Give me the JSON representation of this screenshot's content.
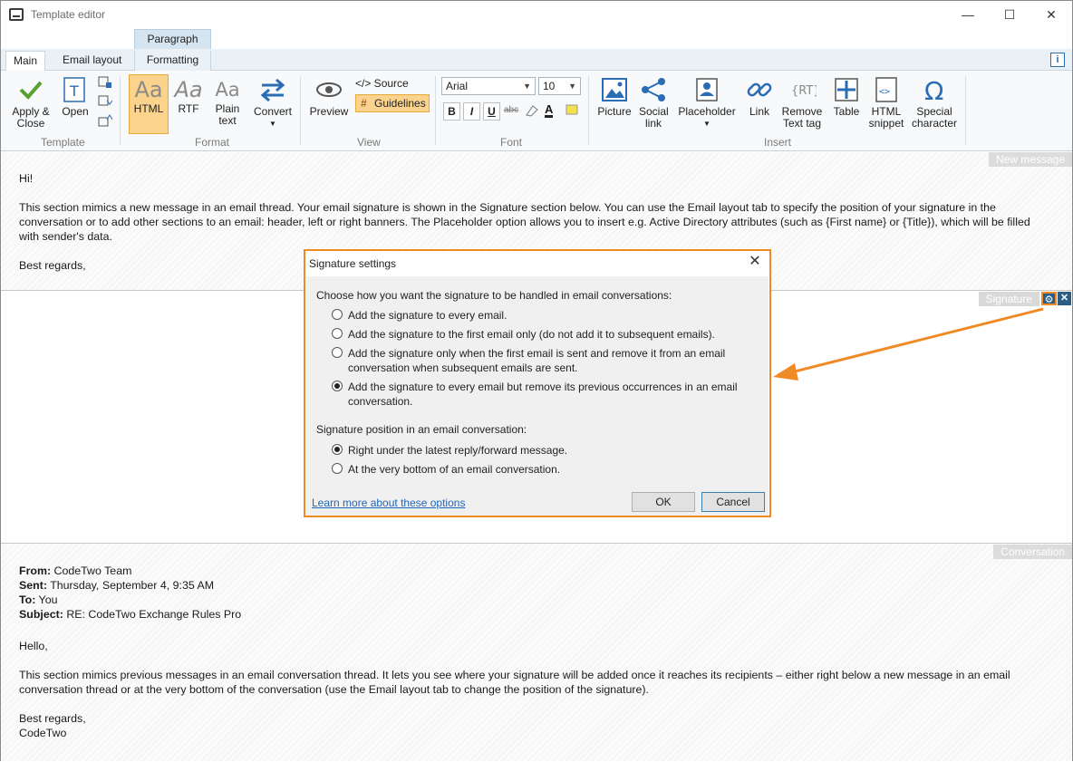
{
  "window": {
    "title": "Template editor",
    "minimize": "—",
    "maximize": "☐",
    "close": "✕"
  },
  "ribbon": {
    "contextual_tab": "Paragraph",
    "tabs": [
      {
        "label": "Main"
      },
      {
        "label": "Email layout"
      },
      {
        "label": "Formatting"
      }
    ],
    "info": "i",
    "template": {
      "apply_close": "Apply & Close",
      "open": "Open",
      "group": "Template"
    },
    "format": {
      "html": "HTML",
      "rtf": "RTF",
      "plain_text": "Plain text",
      "convert": "Convert",
      "aa": "Aa",
      "group": "Format"
    },
    "view": {
      "preview": "Preview",
      "source": "</> Source",
      "guidelines": "Guidelines",
      "group": "View"
    },
    "font": {
      "family": "Arial",
      "size": "10",
      "bold": "B",
      "italic": "I",
      "underline": "U",
      "strike": "abc",
      "color": "A",
      "group": "Font"
    },
    "insert": {
      "picture": "Picture",
      "social_link": "Social link",
      "placeholder": "Placeholder",
      "link": "Link",
      "remove_text_tag": "Remove Text tag",
      "table": "Table",
      "html_snippet": "HTML snippet",
      "special_character": "Special character",
      "group": "Insert"
    }
  },
  "sections": {
    "new_message": {
      "tag": "New message",
      "greeting": "Hi!",
      "body": "This section mimics a new message in an email thread. Your email signature is shown in the Signature section below. You can use the Email layout tab to specify the position of your signature in the conversation or to add other sections to an email: header, left or right banners. The Placeholder option allows you to insert e.g. Active Directory attributes (such as {First name} or {Title}), which will be filled with sender's data.",
      "closing": "Best regards,"
    },
    "signature": {
      "tag": "Signature",
      "settings_icon": "⚙",
      "close_icon": "✕"
    },
    "conversation": {
      "tag": "Conversation",
      "from_label": "From:",
      "from_value": " CodeTwo Team",
      "sent_label": "Sent:",
      "sent_value": " Thursday, September 4, 9:35 AM",
      "to_label": "To:",
      "to_value": " You",
      "subject_label": "Subject:",
      "subject_value": " RE: CodeTwo Exchange Rules Pro",
      "greeting": "Hello,",
      "body": "This section mimics previous messages in an email conversation thread. It lets you see where your signature will be added once it reaches its recipients – either right below a new message in an email conversation thread or at the very bottom of the conversation (use the Email layout tab to change the position of the signature).",
      "closing_1": "Best regards,",
      "closing_2": "CodeTwo"
    }
  },
  "dialog": {
    "title": "Signature settings",
    "close": "✕",
    "question_1": "Choose how you want the signature to be handled in email conversations:",
    "options_1": [
      {
        "label": "Add the signature to every email.",
        "selected": false
      },
      {
        "label": "Add the signature to the first email only (do not add it to subsequent emails).",
        "selected": false
      },
      {
        "label": "Add the signature only when the first email is sent and remove it from an email conversation when subsequent emails are sent.",
        "selected": false
      },
      {
        "label": "Add the signature to every email but remove its previous occurrences in an email conversation.",
        "selected": true
      }
    ],
    "question_2": "Signature position in an email conversation:",
    "options_2": [
      {
        "label": "Right under the latest reply/forward message.",
        "selected": true
      },
      {
        "label": "At the very bottom of an email conversation.",
        "selected": false
      }
    ],
    "learn_more": "Learn more about these options",
    "ok": "OK",
    "cancel": "Cancel"
  },
  "colors": {
    "accent_orange": "#f08a24",
    "ribbon_highlight": "#fbd38d",
    "link_blue": "#2265b8",
    "gear_blue": "#2b5d86"
  }
}
